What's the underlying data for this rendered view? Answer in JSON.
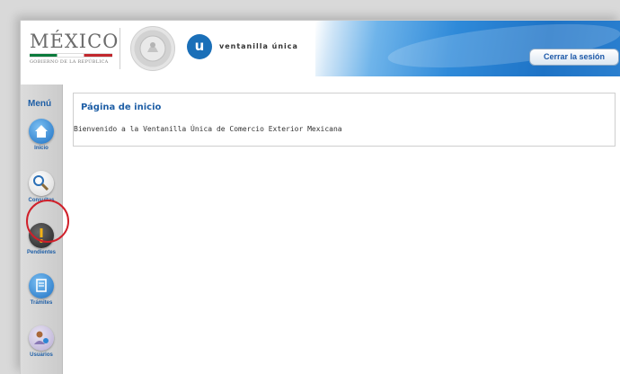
{
  "header": {
    "brand_main": "MÉXICO",
    "brand_sub": "GOBIERNO DE LA REPÚBLICA",
    "vu_letter": "u",
    "vu_name": "ventanilla única",
    "logout_label": "Cerrar la sesión"
  },
  "sidebar": {
    "title": "Menú",
    "items": [
      {
        "label": "Inicio",
        "icon": "home-icon",
        "color": "#2e86d4"
      },
      {
        "label": "Consultas",
        "icon": "search-icon",
        "color": "#ffffff"
      },
      {
        "label": "Pendientes",
        "icon": "alert-icon",
        "color": "#3a3a3a"
      },
      {
        "label": "Trámites",
        "icon": "document-icon",
        "color": "#2e86d4"
      },
      {
        "label": "Usuarios",
        "icon": "users-icon",
        "color": "#8a79b5"
      }
    ]
  },
  "main": {
    "title": "Página de inicio",
    "welcome": "Bienvenido a la Ventanilla Única de Comercio Exterior Mexicana"
  },
  "colors": {
    "accent": "#1f5fa6",
    "highlight": "#d0202a"
  }
}
